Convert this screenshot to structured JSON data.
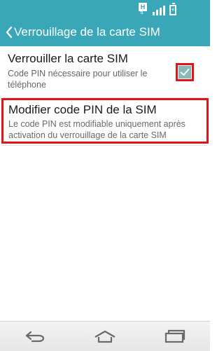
{
  "status_bar": {
    "network_type": "H",
    "icons": [
      "hplus-icon",
      "signal-icon",
      "battery-charging-icon"
    ]
  },
  "app_bar": {
    "title": "Verrouillage de la carte SIM",
    "back_icon": "chevron-left-icon"
  },
  "settings": {
    "lock_sim": {
      "title": "Verrouiller la carte SIM",
      "summary": "Code PIN nécessaire pour utiliser le téléphone",
      "checked": true
    },
    "change_pin": {
      "title": "Modifier code PIN de la SIM",
      "summary": "Le code PIN est modifiable uniquement après activation du verrouillage de la carte SIM"
    }
  },
  "nav_bar": {
    "buttons": [
      "back-icon",
      "home-icon",
      "recent-apps-icon"
    ]
  },
  "colors": {
    "accent": "#3aa7b8",
    "highlight": "#e0141b",
    "checkbox_fill": "#8ab8b4"
  }
}
